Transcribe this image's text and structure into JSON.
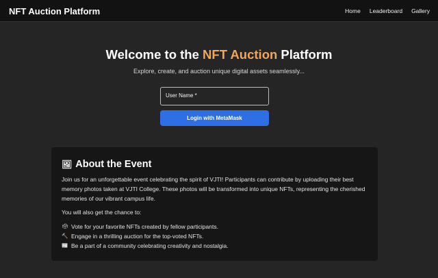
{
  "navbar": {
    "brand": "NFT Auction Platform",
    "links": [
      "Home",
      "Leaderboard",
      "Gallery"
    ]
  },
  "hero": {
    "title_prefix": "Welcome to the ",
    "title_accent": "NFT Auction",
    "title_suffix": " Platform",
    "subtitle": "Explore, create, and auction unique digital assets seamlessly...",
    "username_label": "User Name *",
    "login_button": "Login with MetaMask"
  },
  "about": {
    "icon": "picture-frame-icon",
    "title": "About the Event",
    "paragraph1": "Join us for an unforgettable event celebrating the spirit of VJTI! Participants can contribute by uploading their best memory photos taken at VJTI College. These photos will be transformed into unique NFTs, representing the cherished memories of our vibrant campus life.",
    "paragraph2": "You will also get the chance to:",
    "items": [
      {
        "icon": "ballot-box-icon",
        "text": "Vote for your favorite NFTs created by fellow participants."
      },
      {
        "icon": "hammer-icon",
        "text": "Engage in a thrilling auction for the top-voted NFTs."
      },
      {
        "icon": "newspaper-icon",
        "text": "Be a part of a community celebrating creativity and nostalgia."
      }
    ]
  },
  "colors": {
    "accent": "#f2a65a",
    "button": "#2f6fe4",
    "background": "#252525",
    "navbar": "#121212",
    "card": "#161616"
  }
}
